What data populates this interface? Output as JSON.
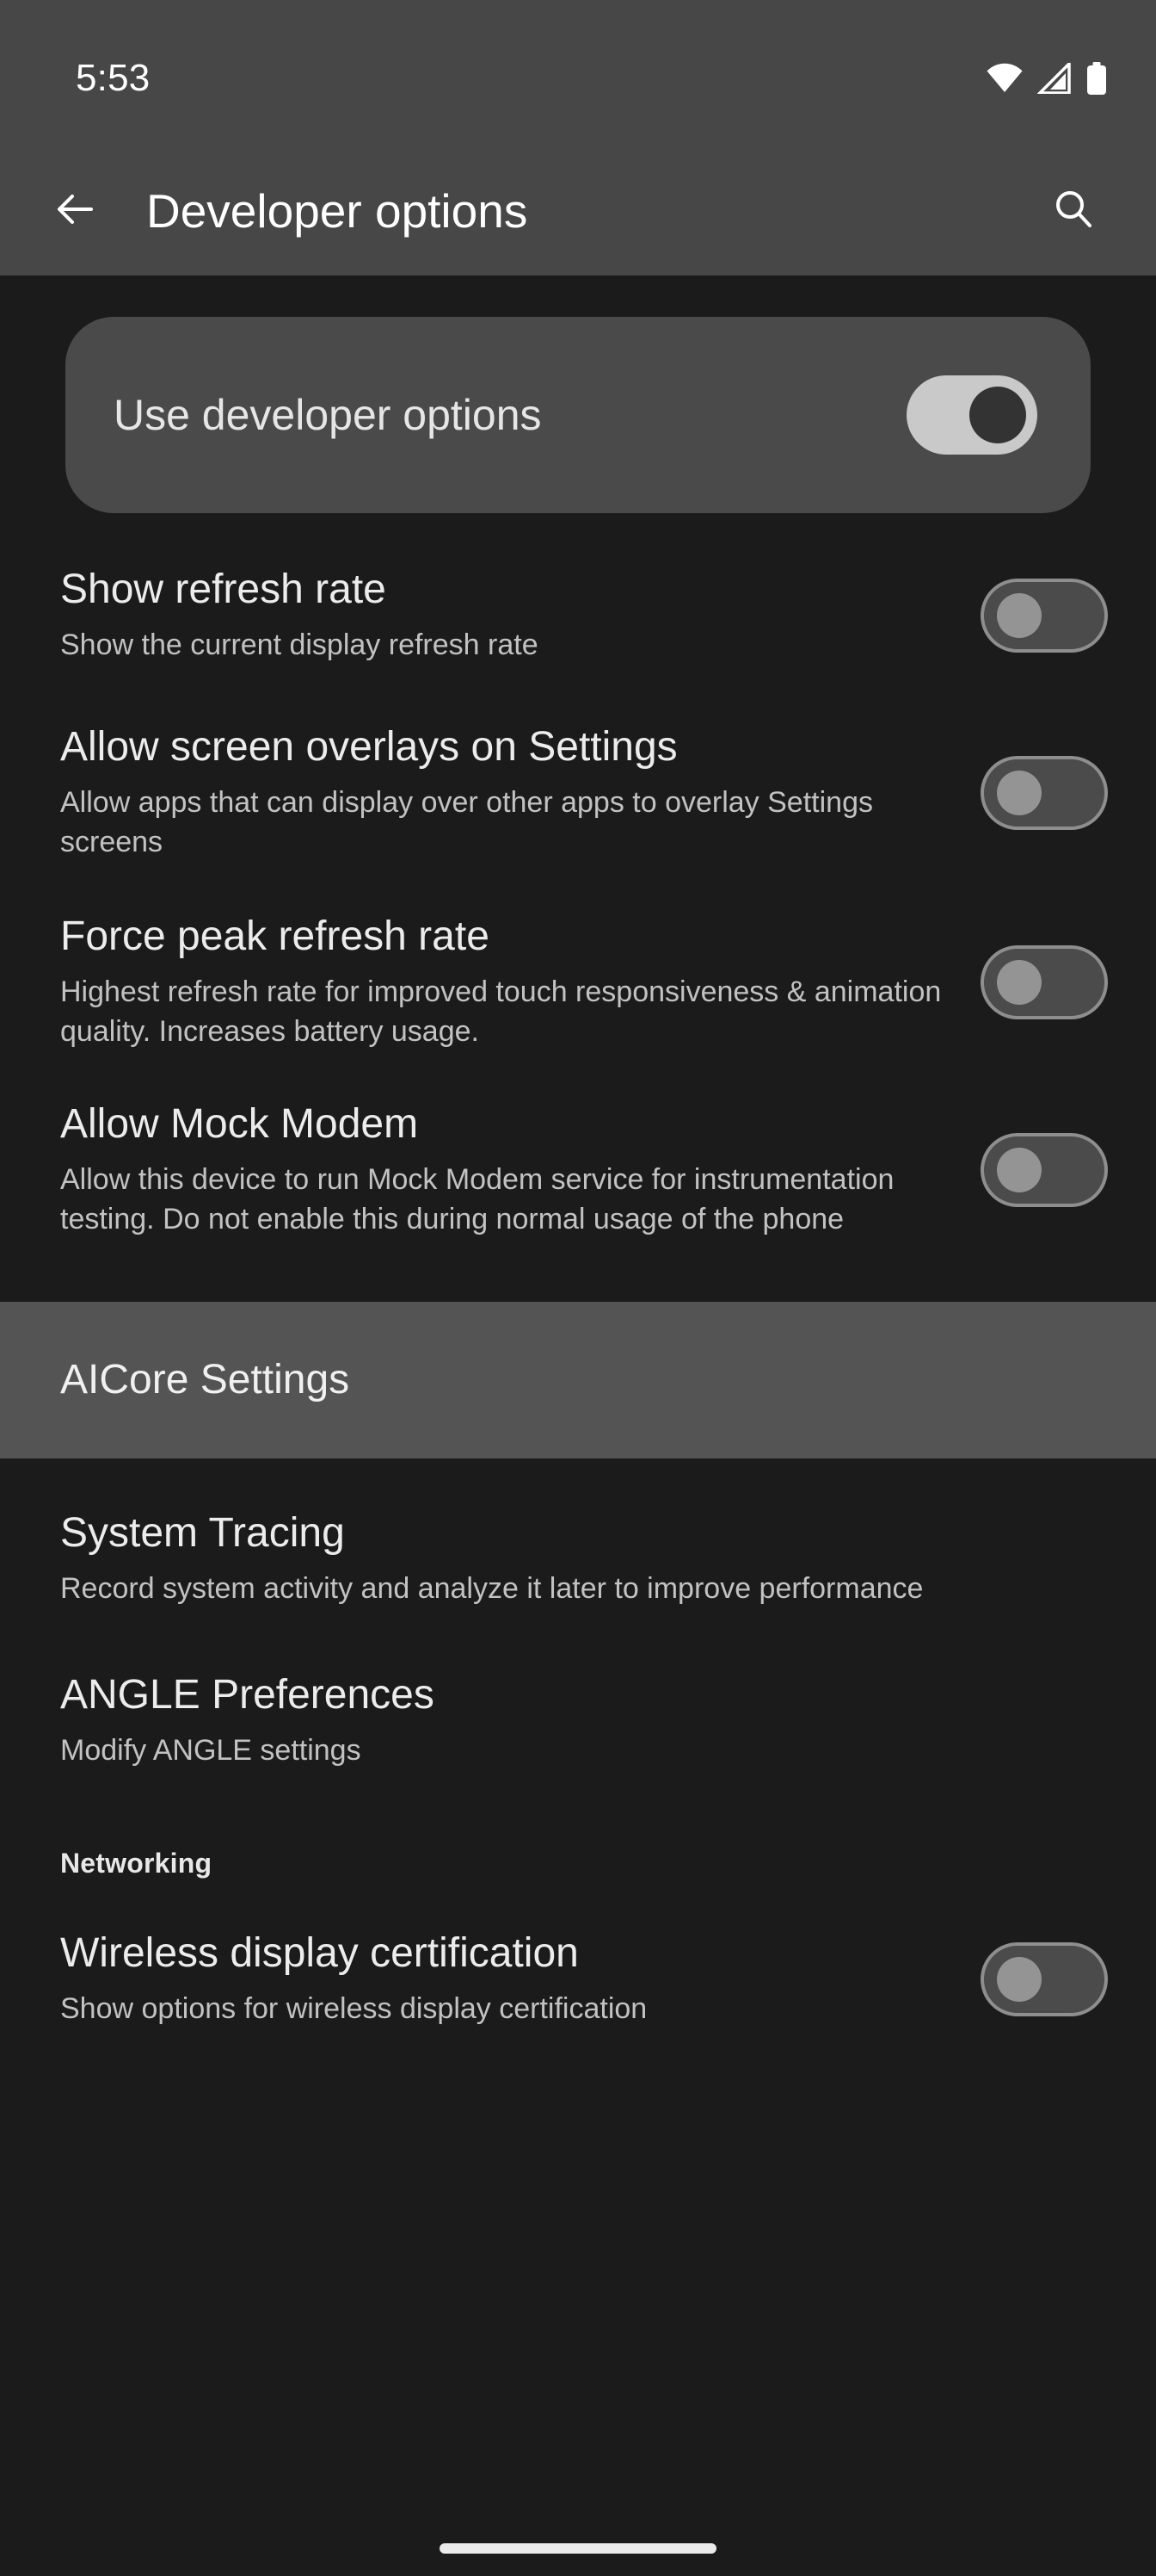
{
  "status_bar": {
    "clock": "5:53",
    "icons": [
      "wifi-icon",
      "cellular-signal-icon",
      "battery-icon"
    ]
  },
  "app_bar": {
    "back_icon": "back-arrow-icon",
    "title": "Developer options",
    "search_icon": "search-icon"
  },
  "main_toggle": {
    "label": "Use developer options",
    "state": "on"
  },
  "preferences": [
    {
      "title": "Show refresh rate",
      "summary": "Show the current display refresh rate",
      "state": "off"
    },
    {
      "title": "Allow screen overlays on Settings",
      "summary": "Allow apps that can display over other apps to overlay Settings screens",
      "state": "off"
    },
    {
      "title": "Force peak refresh rate",
      "summary": "Highest refresh rate for improved touch responsiveness & animation quality. Increases battery usage.",
      "state": "off"
    },
    {
      "title": "Allow Mock Modem",
      "summary": "Allow this device to run Mock Modem service for instrumentation testing. Do not enable this during normal usage of the phone",
      "state": "off"
    }
  ],
  "highlighted_item": {
    "label": "AICore Settings"
  },
  "link_items": [
    {
      "title": "System Tracing",
      "summary": "Record system activity and analyze it later to improve performance"
    },
    {
      "title": "ANGLE Preferences",
      "summary": "Modify ANGLE settings"
    }
  ],
  "networking_section": {
    "header": "Networking",
    "items": [
      {
        "title": "Wireless display certification",
        "summary": "Show options for wireless display certification",
        "state": "off"
      }
    ]
  },
  "colors": {
    "app_bar_bg": "#474747",
    "page_bg": "#1b1b1b",
    "card_bg": "#4a4a4a",
    "highlight_bg": "#545454",
    "switch_on_track": "#c9c9c9",
    "switch_on_thumb": "#333333",
    "switch_off_track": "#4b4b4b",
    "switch_off_border": "#8e8e8e",
    "switch_off_thumb": "#949494",
    "title_text": "#ececec",
    "summary_text": "#c2c2c2"
  }
}
